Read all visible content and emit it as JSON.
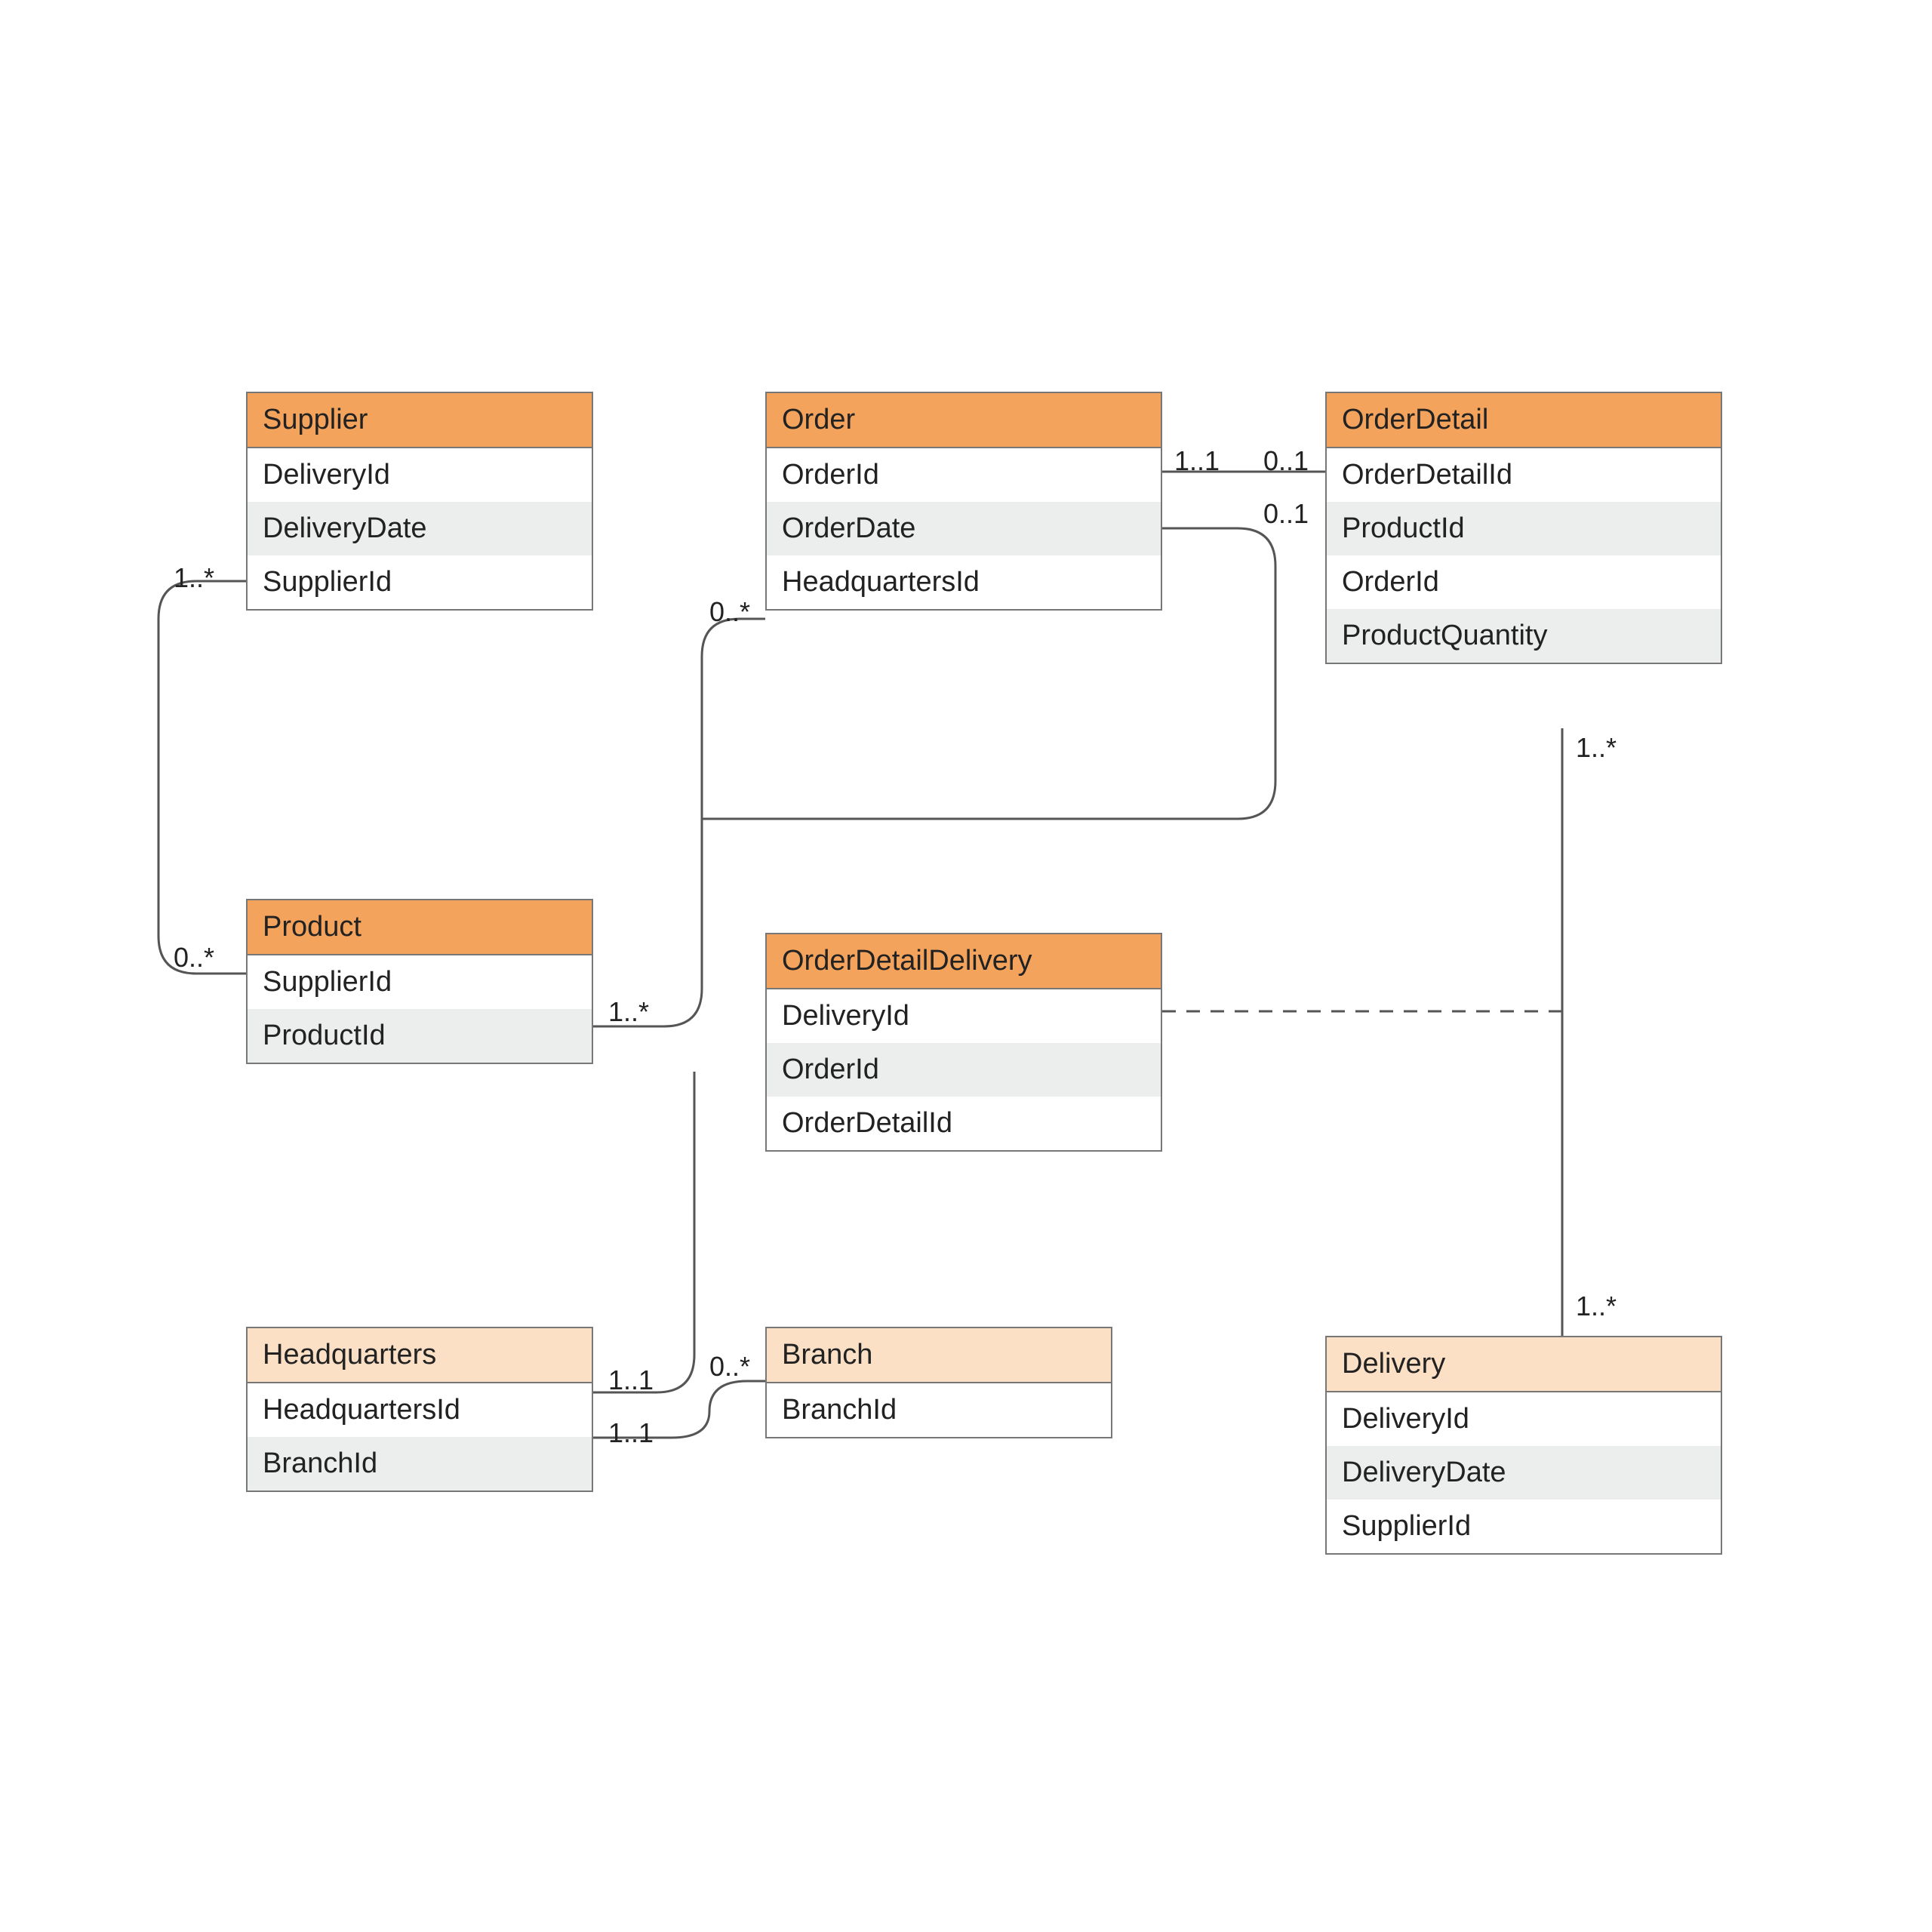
{
  "entities": {
    "supplier": {
      "title": "Supplier",
      "attrs": [
        "DeliveryId",
        "DeliveryDate",
        "SupplierId"
      ]
    },
    "order": {
      "title": "Order",
      "attrs": [
        "OrderId",
        "OrderDate",
        "HeadquartersId"
      ]
    },
    "orderdetail": {
      "title": "OrderDetail",
      "attrs": [
        "OrderDetailId",
        "ProductId",
        "OrderId",
        "ProductQuantity"
      ]
    },
    "product": {
      "title": "Product",
      "attrs": [
        "SupplierId",
        "ProductId"
      ]
    },
    "orderdetaildelivery": {
      "title": "OrderDetailDelivery",
      "attrs": [
        "DeliveryId",
        "OrderId",
        "OrderDetailId"
      ]
    },
    "headquarters": {
      "title": "Headquarters",
      "attrs": [
        "HeadquartersId",
        "BranchId"
      ]
    },
    "branch": {
      "title": "Branch",
      "attrs": [
        "BranchId"
      ]
    },
    "delivery": {
      "title": "Delivery",
      "attrs": [
        "DeliveryId",
        "DeliveryDate",
        "SupplierId"
      ]
    }
  },
  "mults": {
    "supplier_top": "1..*",
    "supplier_bottom": "0..*",
    "order_left": "0..*",
    "order_right_top": "1..1",
    "od_left_top": "0..1",
    "od_left_bot": "0..1",
    "product_right": "1..*",
    "hq_order": "1..1",
    "hq_branch": "1..1",
    "branch_left": "0..*",
    "od_down": "1..*",
    "delivery_up": "1..*"
  },
  "colors": {
    "header_primary": "#f3a35c",
    "header_light": "#fbe0c6",
    "row_alt": "#eceded",
    "border": "#777777",
    "line": "#555555"
  }
}
